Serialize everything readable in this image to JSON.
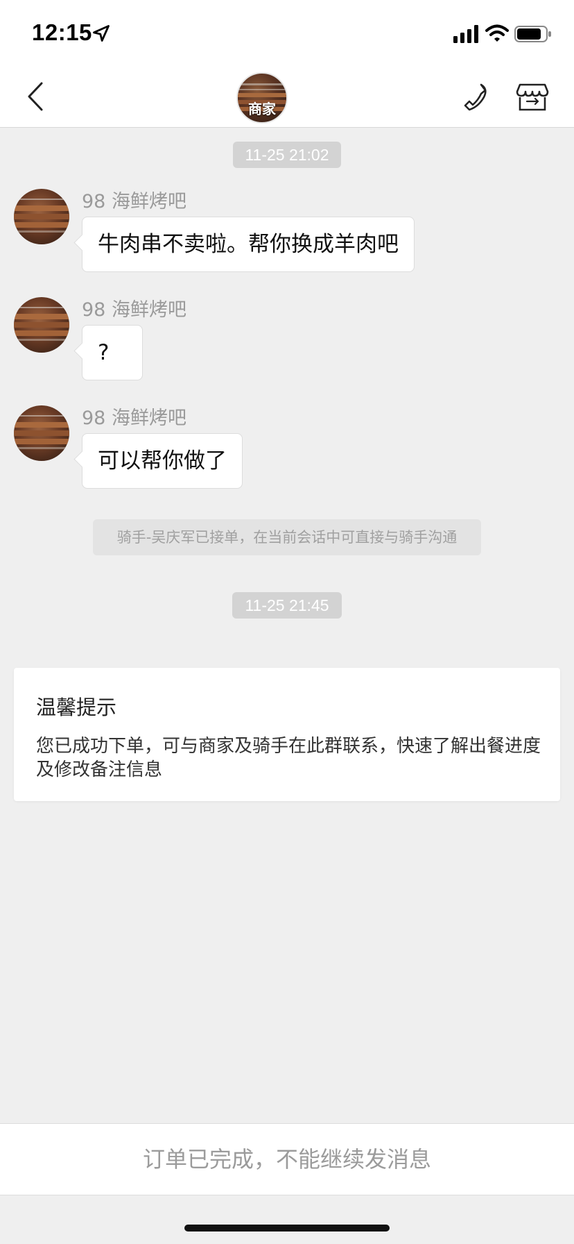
{
  "status_bar": {
    "time": "12:15",
    "location_icon": "location-arrow-icon",
    "signal_icon": "cellular-signal-icon",
    "wifi_icon": "wifi-icon",
    "battery_icon": "battery-icon"
  },
  "nav": {
    "back_icon": "chevron-left-icon",
    "avatar_label": "商家",
    "phone_icon": "phone-icon",
    "store_icon": "store-icon"
  },
  "timestamps": [
    "11-25 21:02",
    "11-25 21:45"
  ],
  "messages": [
    {
      "sender": "98 海鲜烤吧",
      "text": "牛肉串不卖啦。帮你换成羊肉吧"
    },
    {
      "sender": "98 海鲜烤吧",
      "text": "?"
    },
    {
      "sender": "98 海鲜烤吧",
      "text": "可以帮你做了"
    }
  ],
  "system_note": "骑手-吴庆军已接单，在当前会话中可直接与骑手沟通",
  "tip": {
    "title": "温馨提示",
    "body": "您已成功下单，可与商家及骑手在此群联系，快速了解出餐进度及修改备注信息"
  },
  "footer": {
    "notice": "订单已完成，不能继续发消息"
  },
  "colors": {
    "background": "#efefef",
    "timestamp_bg": "#d3d3d3",
    "bubble_bg": "#ffffff",
    "muted_text": "#9a9a9a"
  }
}
